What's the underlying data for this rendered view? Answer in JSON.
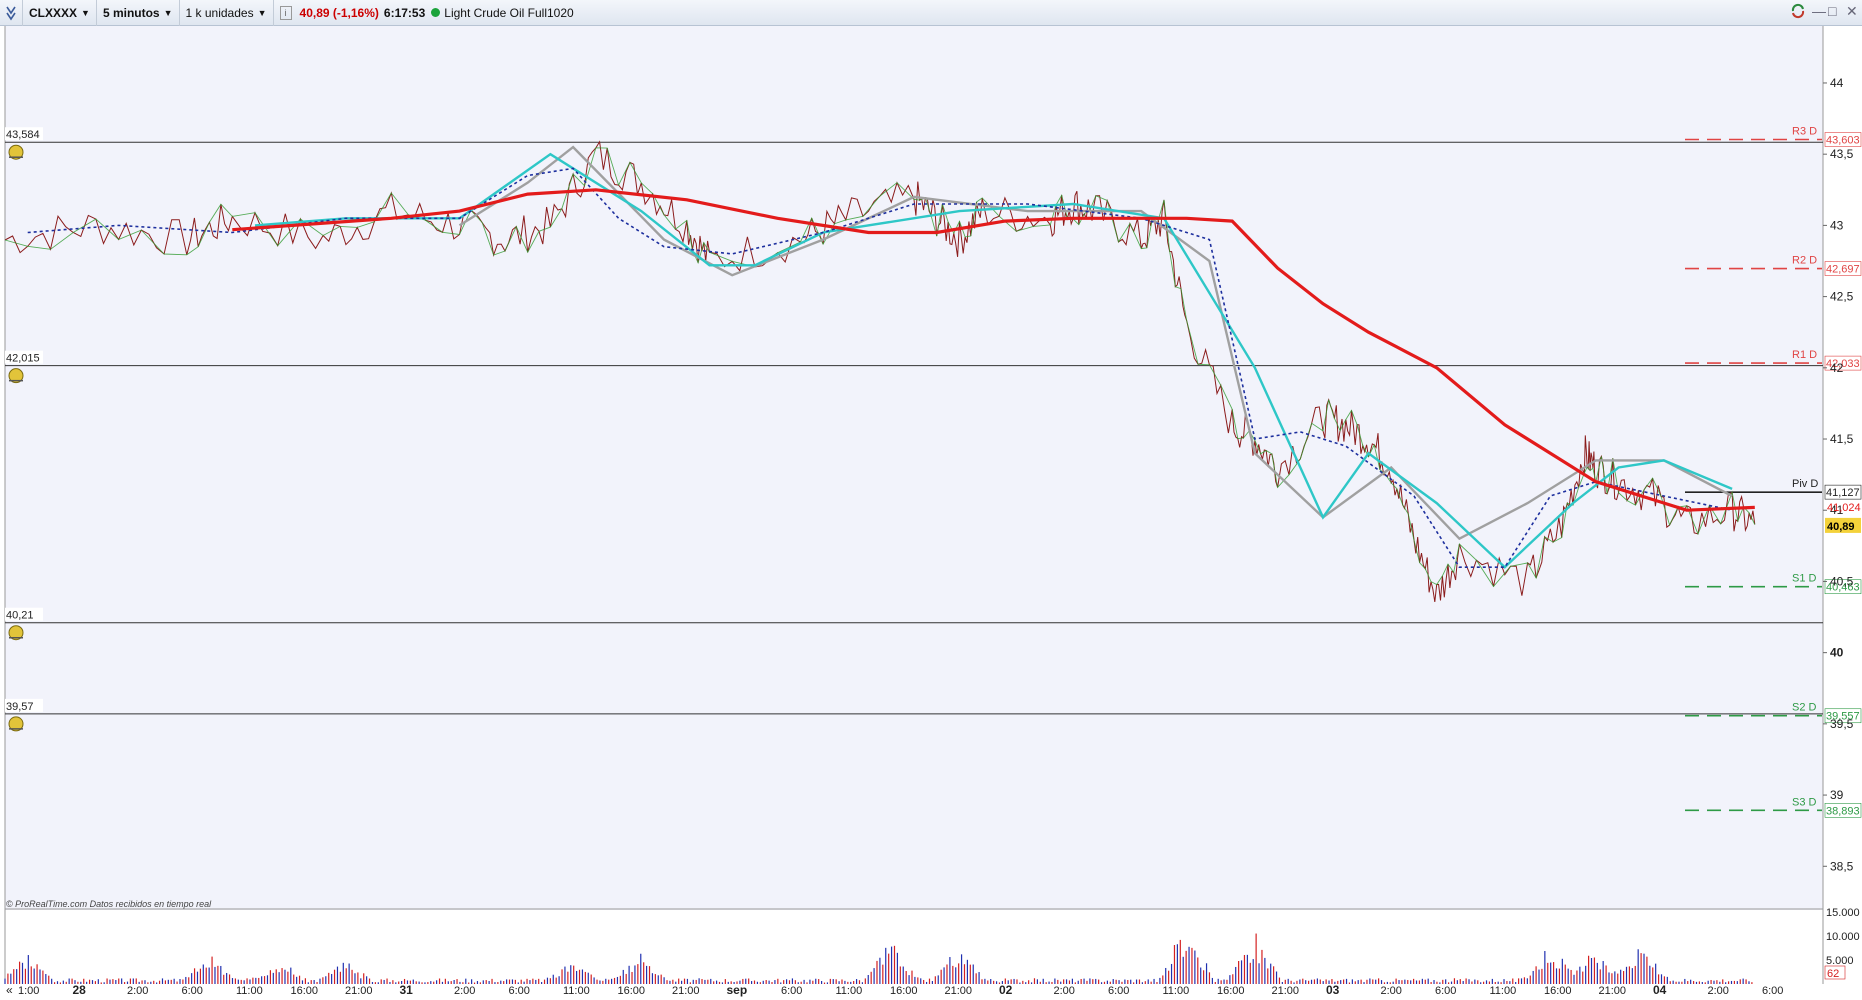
{
  "toolbar": {
    "symbol": "CLXXXX",
    "timeframe": "5 minutos",
    "units": "1 k unidades",
    "price_change": "40,89 (-1,16%)",
    "time": "6:17:53",
    "instrument": "Light Crude Oil Full1020"
  },
  "colors": {
    "price_up": "#2e9a2e",
    "price_down": "#8b1c1c",
    "sma_red": "#e31b1b",
    "ma_gray": "#a0a0a0",
    "ma_cyan": "#2ec7c7",
    "ma_blue_dotted": "#1d2f9e",
    "resistance": "#e04444",
    "support": "#2e9a46",
    "volume_red": "#d42020",
    "volume_blue": "#2030b0"
  },
  "icons": [
    "arrow-down-icon",
    "alarm-bell-icon",
    "refresh-icon",
    "minimize-icon",
    "maximize-icon",
    "close-icon"
  ],
  "copyright": "© ProRealTime.com  Datos recibidos en tiempo real",
  "chart_data": {
    "type": "line",
    "title": "Light Crude Oil Full1020",
    "ylim": [
      38.2,
      44.4
    ],
    "y_ticks": [
      "44",
      "43,5",
      "43",
      "42,5",
      "42",
      "41,5",
      "41",
      "40,5",
      "40",
      "39,5",
      "39",
      "38,5"
    ],
    "x_ticks": [
      "1:00",
      "28",
      "2:00",
      "6:00",
      "11:00",
      "16:00",
      "21:00",
      "31",
      "2:00",
      "6:00",
      "11:00",
      "16:00",
      "21:00",
      "sep",
      "6:00",
      "11:00",
      "16:00",
      "21:00",
      "02",
      "2:00",
      "6:00",
      "11:00",
      "16:00",
      "21:00",
      "03",
      "2:00",
      "6:00",
      "11:00",
      "16:00",
      "21:00",
      "04",
      "2:00",
      "6:00"
    ],
    "x_day_labels": [
      "28",
      "31",
      "sep",
      "02",
      "03",
      "04"
    ],
    "last_price": "40,89",
    "horizontal_lines": [
      {
        "label": "43,584",
        "value": 43.584
      },
      {
        "label": "42,015",
        "value": 42.015
      },
      {
        "label": "40,21",
        "value": 40.21
      },
      {
        "label": "39,57",
        "value": 39.57
      }
    ],
    "pivot_levels": [
      {
        "name": "R3 D",
        "label": "43,603",
        "value": 43.603,
        "kind": "resistance"
      },
      {
        "name": "R2 D",
        "label": "42,697",
        "value": 42.697,
        "kind": "resistance"
      },
      {
        "name": "R1 D",
        "label": "42,033",
        "value": 42.033,
        "kind": "resistance"
      },
      {
        "name": "Piv D",
        "label": "41,127",
        "value": 41.127,
        "kind": "pivot"
      },
      {
        "name": "S1 D",
        "label": "40,463",
        "value": 40.463,
        "kind": "support"
      },
      {
        "name": "S2 D",
        "label": "39,557",
        "value": 39.557,
        "kind": "support"
      },
      {
        "name": "S3 D",
        "label": "38,893",
        "value": 38.893,
        "kind": "support"
      }
    ],
    "current_ma_label": "41,024",
    "series": [
      {
        "name": "",
        "style": "price",
        "x": [
          0,
          4,
          8,
          10,
          14,
          17,
          20,
          22,
          24,
          26,
          28,
          30,
          31,
          35,
          37,
          40,
          41,
          42,
          43,
          46,
          47,
          48,
          50,
          51,
          52,
          54,
          55,
          56,
          58,
          59,
          60,
          61,
          62,
          63,
          64,
          67,
          68.5,
          69.5,
          70,
          71,
          72.5,
          74,
          76,
          77
        ],
        "y": [
          42.9,
          43.0,
          42.9,
          43.05,
          42.9,
          43.1,
          43.0,
          42.9,
          43.0,
          43.5,
          43.3,
          43.0,
          42.75,
          42.9,
          43.05,
          43.2,
          43.05,
          42.9,
          43.1,
          43.05,
          43.15,
          43.1,
          42.9,
          43.05,
          42.3,
          41.6,
          41.5,
          41.3,
          41.65,
          41.6,
          41.5,
          41.3,
          40.8,
          40.4,
          40.7,
          40.5,
          40.9,
          41.4,
          41.3,
          41.2,
          41.1,
          40.9,
          41.0,
          40.9
        ]
      },
      {
        "name": "",
        "style": "ma_red",
        "x": [
          10,
          17,
          20,
          23,
          26,
          30,
          34,
          38,
          41,
          44,
          47,
          50,
          52,
          54,
          56,
          58,
          60,
          63,
          66,
          70,
          74,
          77
        ],
        "y": [
          42.97,
          43.05,
          43.1,
          43.22,
          43.25,
          43.18,
          43.05,
          42.95,
          42.95,
          43.03,
          43.05,
          43.05,
          43.05,
          43.03,
          42.7,
          42.45,
          42.25,
          42.0,
          41.6,
          41.2,
          41.0,
          41.02
        ]
      },
      {
        "name": "",
        "style": "ma_gray",
        "x": [
          20,
          23,
          25,
          29,
          32,
          36,
          40,
          45,
          50,
          53,
          55,
          58,
          61,
          64,
          67,
          70,
          73,
          76
        ],
        "y": [
          43.0,
          43.3,
          43.55,
          42.9,
          42.65,
          42.9,
          43.2,
          43.1,
          43.1,
          42.75,
          41.4,
          40.95,
          41.3,
          40.8,
          41.05,
          41.35,
          41.35,
          41.1
        ]
      },
      {
        "name": "",
        "style": "ma_cyan",
        "x": [
          11,
          15,
          20,
          24,
          28,
          31,
          33,
          36,
          42,
          47,
          51,
          55,
          58,
          60,
          63,
          66,
          69,
          71,
          73,
          76
        ],
        "y": [
          43.0,
          43.05,
          43.05,
          43.5,
          43.1,
          42.72,
          42.72,
          42.95,
          43.1,
          43.15,
          43.05,
          42.0,
          40.95,
          41.4,
          41.05,
          40.6,
          41.05,
          41.3,
          41.35,
          41.15
        ]
      },
      {
        "name": "",
        "style": "ma_blue",
        "x": [
          1,
          5,
          10,
          15,
          20,
          23,
          25,
          27,
          29,
          32,
          36,
          40,
          45,
          50,
          53,
          55,
          57,
          59,
          62,
          64,
          66,
          68,
          70,
          73,
          76
        ],
        "y": [
          42.95,
          43.0,
          42.95,
          43.05,
          43.05,
          43.35,
          43.4,
          43.05,
          42.85,
          42.8,
          42.95,
          43.15,
          43.15,
          43.05,
          42.9,
          41.5,
          41.55,
          41.45,
          41.1,
          40.6,
          40.6,
          41.1,
          41.2,
          41.1,
          41.0
        ]
      }
    ],
    "volume": {
      "y_ticks": [
        "15.000",
        "10.000",
        "5.000"
      ],
      "ylim": [
        0,
        15000
      ],
      "last_label": "62",
      "peaks_x": [
        1,
        9,
        12,
        15,
        25,
        28,
        39,
        42,
        52,
        55,
        68,
        70,
        72
      ],
      "peaks_y": [
        6000,
        5500,
        5000,
        4200,
        4800,
        6000,
        9000,
        7000,
        14000,
        11000,
        8000,
        6500,
        7000
      ]
    }
  }
}
